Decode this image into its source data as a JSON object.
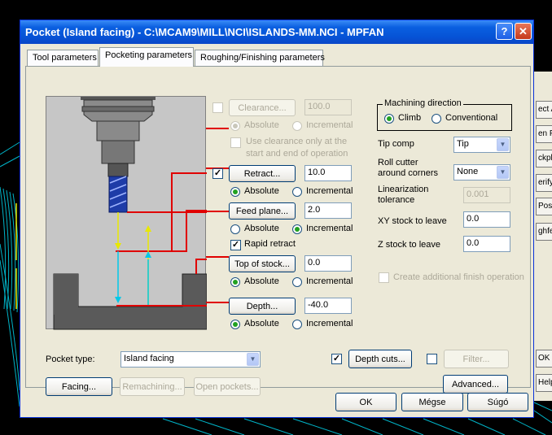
{
  "dialog": {
    "title": "Pocket (Island facing) - C:\\MCAM9\\MILL\\NCI\\ISLANDS-MM.NCI - MPFAN",
    "help_glyph": "?",
    "close_glyph": "✕"
  },
  "tabs": [
    "Tool parameters",
    "Pocketing parameters",
    "Roughing/Finishing parameters"
  ],
  "clearance": {
    "label": "Clearance...",
    "value": "100.0",
    "absolute": "Absolute",
    "incremental": "Incremental",
    "use_only_line1": "Use clearance only at the",
    "use_only_line2": "start and end of operation",
    "checked": false
  },
  "retract": {
    "label": "Retract...",
    "value": "10.0",
    "absolute": "Absolute",
    "incremental": "Incremental",
    "checked": "✓"
  },
  "feed_plane": {
    "label": "Feed plane...",
    "value": "2.0",
    "absolute": "Absolute",
    "incremental": "Incremental"
  },
  "rapid_retract": {
    "label": "Rapid retract",
    "checked": "✓"
  },
  "top_of_stock": {
    "label": "Top of stock...",
    "value": "0.0",
    "absolute": "Absolute",
    "incremental": "Incremental"
  },
  "depth": {
    "label": "Depth...",
    "value": "-40.0",
    "absolute": "Absolute",
    "incremental": "Incremental"
  },
  "machining_direction": {
    "label": "Machining direction",
    "climb": "Climb",
    "conventional": "Conventional"
  },
  "tip_comp": {
    "label": "Tip comp",
    "value": "Tip"
  },
  "roll_cutter": {
    "label_line1": "Roll cutter",
    "label_line2": "around corners",
    "value": "None"
  },
  "linearization": {
    "label_line1": "Linearization",
    "label_line2": "tolerance",
    "value": "0.001"
  },
  "xy_stock": {
    "label": "XY stock to leave",
    "value": "0.0"
  },
  "z_stock": {
    "label": "Z stock to leave",
    "value": "0.0"
  },
  "create_finish": {
    "label": "Create additional finish operation"
  },
  "pocket_type": {
    "label": "Pocket type:",
    "value": "Island facing"
  },
  "depth_cuts": {
    "label": "Depth cuts...",
    "checked": "✓"
  },
  "filter": {
    "label": "Filter..."
  },
  "advanced": {
    "label": "Advanced..."
  },
  "facing": {
    "label": "Facing..."
  },
  "remachining": {
    "label": "Remachining..."
  },
  "open_pockets": {
    "label": "Open pockets..."
  },
  "footer": {
    "ok": "OK",
    "cancel": "Mégse",
    "help": "Súgó"
  },
  "background_window": {
    "items": [
      "ect A",
      "en F",
      "ckpl",
      "erify",
      "Post",
      "ghfee",
      "OK",
      "Help"
    ]
  },
  "colors": {
    "title_blue": "#0653d6",
    "dialog_bg": "#ece9d8",
    "guide_red": "#e00000",
    "arrow_yellow": "#e8e800",
    "arrow_cyan": "#00c8e8",
    "toolpath_cyan": "#00b0c8"
  }
}
